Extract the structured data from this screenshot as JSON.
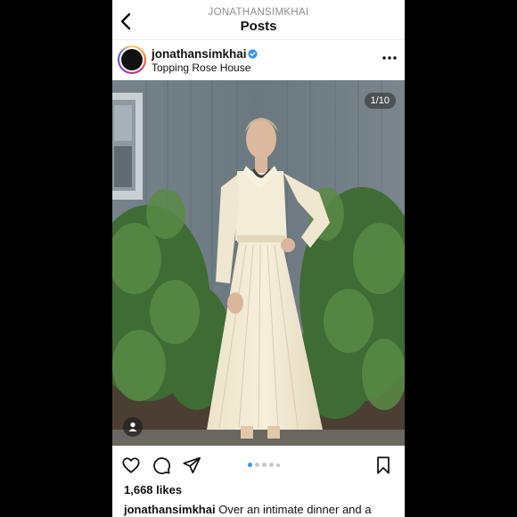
{
  "header": {
    "subtitle": "JONATHANSIMKHAI",
    "title": "Posts"
  },
  "post": {
    "username": "jonathansimkhai",
    "location": "Topping Rose House",
    "counter": "1/10",
    "likes": "1,668 likes",
    "caption_user": "jonathansimkhai",
    "caption_text": "Over an intimate dinner and a",
    "carousel": {
      "total_dots": 5,
      "active_index": 0
    }
  },
  "icons": {
    "back": "chevron-left-icon",
    "verified": "verified-badge-icon",
    "more": "more-horizontal-icon",
    "tag": "person-tag-icon",
    "like": "heart-icon",
    "comment": "comment-icon",
    "share": "send-icon",
    "save": "bookmark-icon"
  },
  "colors": {
    "verified": "#3897f0",
    "active_dot": "#3897f0",
    "text": "#111111",
    "muted": "#8e8e8e"
  }
}
